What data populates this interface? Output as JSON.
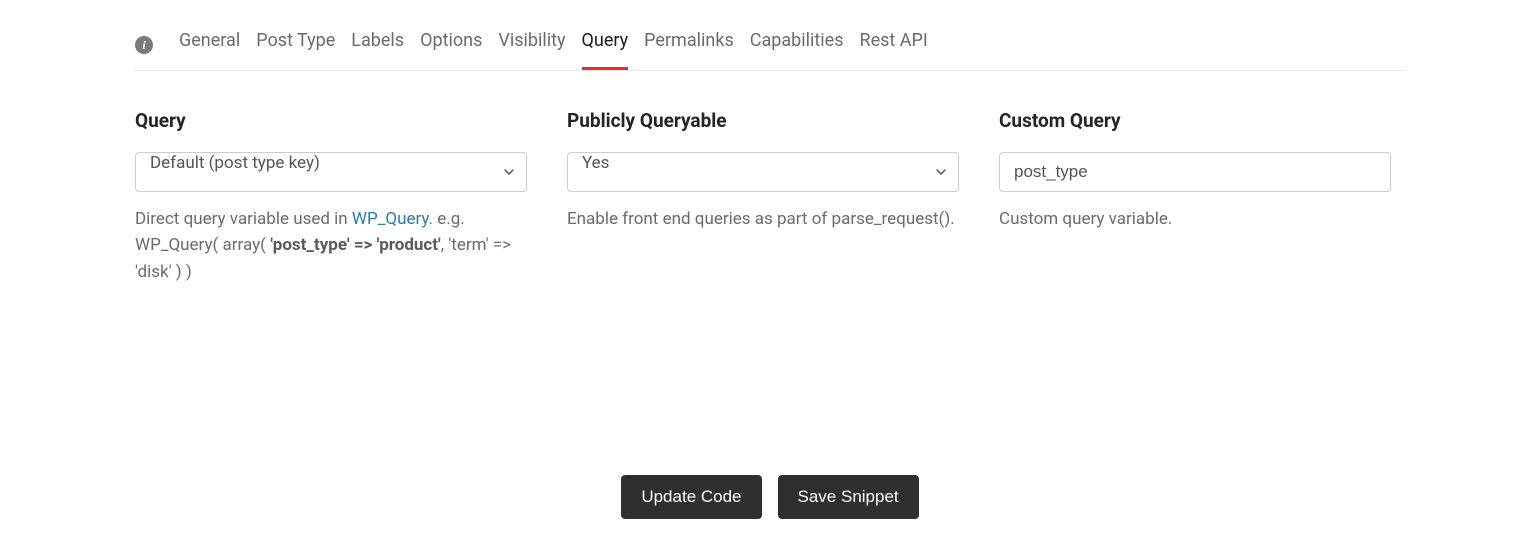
{
  "tabs": {
    "items": [
      "General",
      "Post Type",
      "Labels",
      "Options",
      "Visibility",
      "Query",
      "Permalinks",
      "Capabilities",
      "Rest API"
    ],
    "activeIndex": 5
  },
  "fields": {
    "query": {
      "label": "Query",
      "value": "Default (post type key)",
      "help_prefix": "Direct query variable used in ",
      "help_link": "WP_Query",
      "help_mid": ". e.g. WP_Query( array( ",
      "help_bold": "'post_type' => 'product'",
      "help_suffix": ", 'term' => 'disk' ) )"
    },
    "publicly_queryable": {
      "label": "Publicly Queryable",
      "value": "Yes",
      "help": "Enable front end queries as part of parse_request()."
    },
    "custom_query": {
      "label": "Custom Query",
      "value": "post_type",
      "help": "Custom query variable."
    }
  },
  "actions": {
    "update": "Update Code",
    "save": "Save Snippet"
  }
}
